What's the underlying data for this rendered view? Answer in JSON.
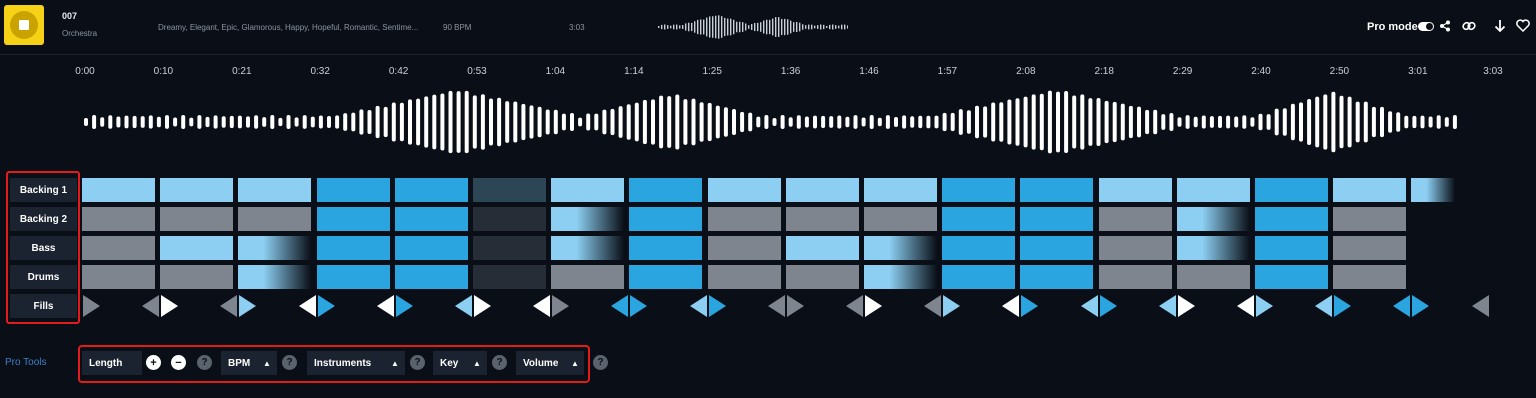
{
  "track": {
    "title": "007",
    "genre": "Orchestra",
    "tags": "Dreamy, Elegant, Epic, Glamorous, Happy, Hopeful, Romantic, Sentime...",
    "bpm": "90 BPM",
    "duration": "3:03"
  },
  "topbar": {
    "pro_mode_label": "Pro mode",
    "pro_mode_on": true,
    "icons": [
      "share-icon",
      "link-icon",
      "download-icon",
      "heart-icon"
    ]
  },
  "timeline": {
    "labels": [
      "0:00",
      "0:10",
      "0:21",
      "0:32",
      "0:42",
      "0:53",
      "1:04",
      "1:14",
      "1:25",
      "1:36",
      "1:46",
      "1:57",
      "2:08",
      "2:18",
      "2:29",
      "2:40",
      "2:50",
      "3:01",
      "3:03"
    ]
  },
  "tracks": [
    {
      "label": "Backing 1",
      "blocks": [
        "light",
        "light",
        "light",
        "blue",
        "blue",
        "dark1",
        "light",
        "blue",
        "light",
        "light",
        "light",
        "blue",
        "blue",
        "light",
        "light",
        "blue",
        "light",
        "fade-light"
      ]
    },
    {
      "label": "Backing 2",
      "blocks": [
        "gray",
        "gray",
        "gray",
        "blue",
        "blue",
        "dark2",
        "fade-light",
        "blue",
        "gray",
        "gray",
        "gray",
        "blue",
        "blue",
        "gray",
        "fade-light",
        "blue",
        "gray"
      ]
    },
    {
      "label": "Bass",
      "blocks": [
        "gray",
        "light",
        "fade-light",
        "blue",
        "blue",
        "dark2",
        "fade-light",
        "blue",
        "gray",
        "light",
        "fade-light",
        "blue",
        "blue",
        "gray",
        "fade-light",
        "blue",
        "gray"
      ]
    },
    {
      "label": "Drums",
      "blocks": [
        "gray",
        "gray",
        "fade-light",
        "blue",
        "blue",
        "dark2",
        "gray",
        "blue",
        "gray",
        "gray",
        "fade-light",
        "blue",
        "blue",
        "gray",
        "gray",
        "blue",
        "gray"
      ]
    },
    {
      "label": "Fills",
      "fills": [
        {
          "l": null,
          "r": "gray"
        },
        {
          "l": "gray",
          "r": "white"
        },
        {
          "l": "gray",
          "r": "light"
        },
        {
          "l": "white",
          "r": "blue"
        },
        {
          "l": "white",
          "r": "blue"
        },
        {
          "l": "light",
          "r": "white"
        },
        {
          "l": "white",
          "r": "gray"
        },
        {
          "l": "blue",
          "r": "blue"
        },
        {
          "l": "light",
          "r": "blue"
        },
        {
          "l": "gray",
          "r": "gray"
        },
        {
          "l": "gray",
          "r": "white"
        },
        {
          "l": "gray",
          "r": "light"
        },
        {
          "l": "white",
          "r": "blue"
        },
        {
          "l": "light",
          "r": "blue"
        },
        {
          "l": "light",
          "r": "white"
        },
        {
          "l": "white",
          "r": "light"
        },
        {
          "l": "light",
          "r": "blue"
        },
        {
          "l": "blue",
          "r": "blue"
        },
        {
          "l": "gray",
          "r": null
        }
      ]
    }
  ],
  "pro_tools": {
    "label": "Pro Tools",
    "length_label": "Length",
    "bpm_label": "BPM",
    "instruments_label": "Instruments",
    "key_label": "Key",
    "volume_label": "Volume",
    "plus": "+",
    "minus": "−",
    "help": "?",
    "caret": "▲"
  },
  "colors": {
    "background": "#0a0f17",
    "light_block": "#8ccff2",
    "blue_block": "#2ba5e0",
    "gray_block": "#7e858e",
    "highlight_border": "#e31b1b",
    "accent_text": "#3f7fc6"
  }
}
